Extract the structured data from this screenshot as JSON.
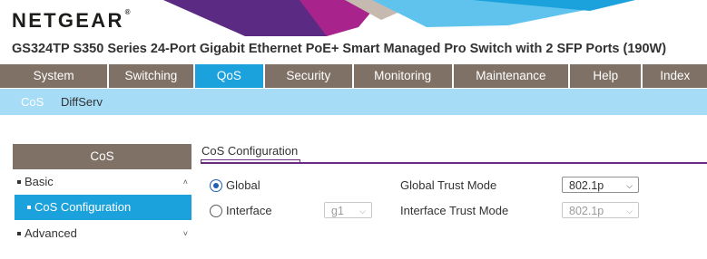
{
  "header": {
    "brand": "NETGEAR",
    "brand_mark": "®",
    "model": "GS324TP S350 Series 24-Port Gigabit Ethernet PoE+ Smart Managed Pro Switch with 2 SFP Ports (190W)",
    "banner_colors": [
      "#5b2a82",
      "#a8238c",
      "#c6b9b0",
      "#5fc3ee",
      "#1ba1dc"
    ]
  },
  "nav": {
    "tabs": [
      {
        "label": "System"
      },
      {
        "label": "Switching"
      },
      {
        "label": "QoS"
      },
      {
        "label": "Security"
      },
      {
        "label": "Monitoring"
      },
      {
        "label": "Maintenance"
      },
      {
        "label": "Help"
      },
      {
        "label": "Index"
      }
    ],
    "active": "QoS",
    "active_color": "#1ba1dc",
    "tab_color": "#7f7166"
  },
  "subnav": {
    "items": [
      {
        "label": "CoS"
      },
      {
        "label": "DiffServ"
      }
    ],
    "active": "CoS",
    "bg_color": "#a6dcf6"
  },
  "sidebar": {
    "title": "CoS",
    "items": [
      {
        "label": "Basic",
        "icon": "chevron-up-icon"
      },
      {
        "label": "CoS Configuration"
      },
      {
        "label": "Advanced",
        "icon": "chevron-down-icon"
      }
    ]
  },
  "content": {
    "tab_label": "CoS Configuration",
    "global": {
      "radio_label": "Global",
      "selected": true,
      "trust_mode_label": "Global Trust Mode",
      "trust_mode_value": "802.1p"
    },
    "interface": {
      "radio_label": "Interface",
      "selected": false,
      "port_value": "g1",
      "trust_mode_label": "Interface Trust Mode",
      "trust_mode_value": "802.1p"
    }
  }
}
